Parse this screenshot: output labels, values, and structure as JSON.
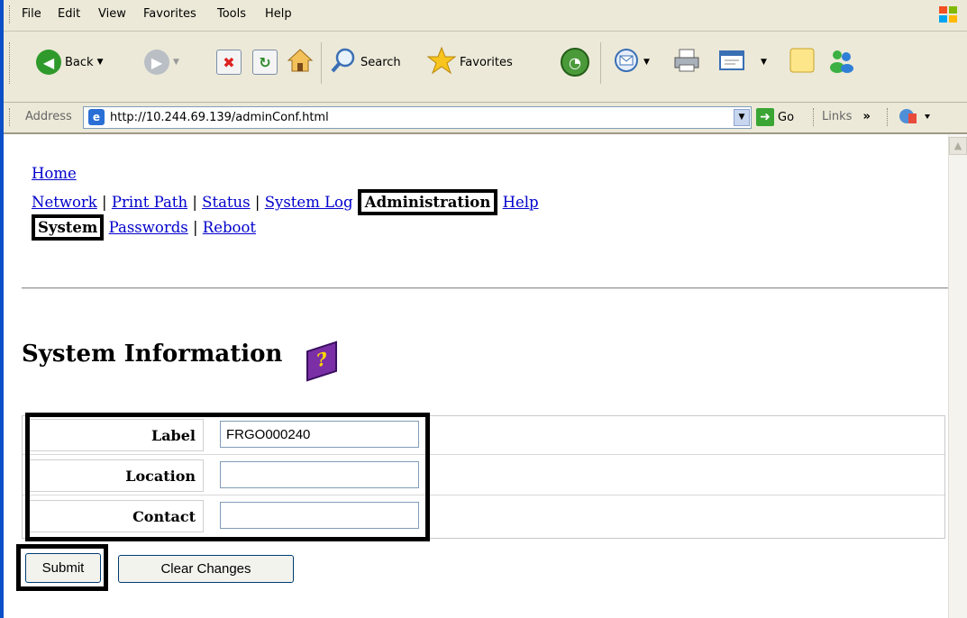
{
  "menu": [
    {
      "label": "File"
    },
    {
      "label": "Edit"
    },
    {
      "label": "View"
    },
    {
      "label": "Favorites"
    },
    {
      "label": "Tools"
    },
    {
      "label": "Help"
    }
  ],
  "toolbar": {
    "back_label": "Back",
    "search_label": "Search",
    "favorites_label": "Favorites"
  },
  "address": {
    "label": "Address",
    "url": "http://10.244.69.139/adminConf.html",
    "go_label": "Go",
    "links_label": "Links"
  },
  "nav": {
    "home": "Home",
    "network": "Network",
    "print_path": "Print Path",
    "status": "Status",
    "system_log": "System Log",
    "administration": "Administration",
    "help": "Help",
    "system": "System",
    "passwords": "Passwords",
    "reboot": "Reboot",
    "separator": "|"
  },
  "page": {
    "title": "System Information"
  },
  "form": {
    "fields": [
      {
        "label": "Label",
        "value": "FRGO000240"
      },
      {
        "label": "Location",
        "value": ""
      },
      {
        "label": "Contact",
        "value": ""
      }
    ],
    "submit_label": "Submit",
    "clear_label": "Clear Changes"
  },
  "colors": {
    "link": "#0000cc",
    "chrome": "#ece9d8",
    "window_edge": "#0a4fc7"
  }
}
